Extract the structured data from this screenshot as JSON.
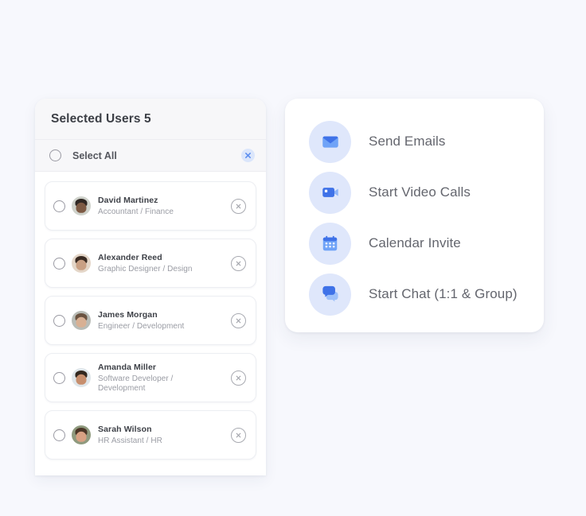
{
  "page": {
    "background_color": "#f7f8fd"
  },
  "users_panel": {
    "header_title": "Selected Users 5",
    "select_all": {
      "label": "Select All",
      "checked": false,
      "clear_icon": "close-x-icon",
      "clear_icon_color": "#5b8def",
      "clear_badge_color": "#dbe6fb"
    },
    "users": [
      {
        "name": "David Martinez",
        "role": "Accountant / Finance",
        "avatar": "photo-avatar",
        "checked": false,
        "remove_icon": "circle-x-icon",
        "skin": "#7d5a44",
        "hair": "#2f2723",
        "bg": "#cfd2cb"
      },
      {
        "name": "Alexander Reed",
        "role": "Graphic Designer / Design",
        "avatar": "photo-avatar",
        "checked": false,
        "remove_icon": "circle-x-icon",
        "skin": "#c9a084",
        "hair": "#3a2b22",
        "bg": "#e4d6c8"
      },
      {
        "name": "James Morgan",
        "role": "Engineer / Development",
        "avatar": "photo-avatar",
        "checked": false,
        "remove_icon": "circle-x-icon",
        "skin": "#d8b093",
        "hair": "#6b5340",
        "bg": "#b9bcb6"
      },
      {
        "name": "Amanda Miller",
        "role": "Software Developer /\nDevelopment",
        "avatar": "photo-avatar",
        "checked": false,
        "remove_icon": "circle-x-icon",
        "skin": "#c78f6e",
        "hair": "#33281f",
        "bg": "#dfe6ea"
      },
      {
        "name": "Sarah Wilson",
        "role": "HR Assistant / HR",
        "avatar": "photo-avatar",
        "checked": false,
        "remove_icon": "circle-x-icon",
        "skin": "#d7a183",
        "hair": "#4a3526",
        "bg": "#8f9a7e"
      }
    ]
  },
  "actions_panel": {
    "icon_circle_color": "#dfe7fb",
    "accent_color": "#3f72e8",
    "accent_light_color": "#7fa8f5",
    "actions": [
      {
        "label": "Send Emails",
        "icon": "envelope-icon"
      },
      {
        "label": "Start Video Calls",
        "icon": "video-camera-icon"
      },
      {
        "label": "Calendar Invite",
        "icon": "calendar-icon"
      },
      {
        "label": "Start Chat (1:1 & Group)",
        "icon": "chat-bubbles-icon"
      }
    ]
  }
}
